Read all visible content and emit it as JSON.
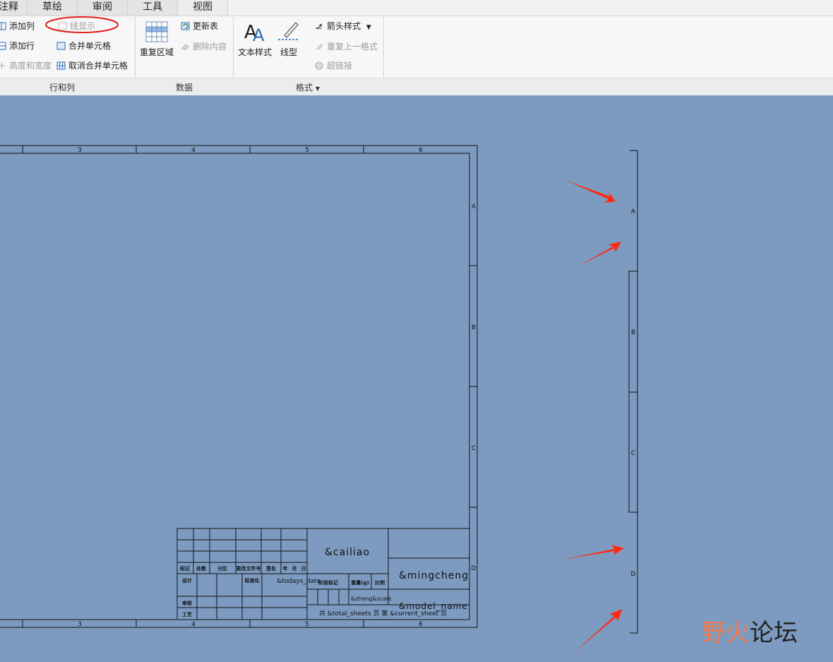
{
  "tabs": [
    "注释",
    "草绘",
    "审阅",
    "工具",
    "视图"
  ],
  "ribbon": {
    "rows_cols": {
      "add_column": "添加列",
      "add_row": "添加行",
      "height_width": "高度和宽度",
      "line_display": "线显示",
      "merge_cells": "合并单元格",
      "unmerge_cells": "取消合并单元格",
      "group_label": "行和列"
    },
    "data": {
      "repeat_region": "重复区域",
      "update_table": "更新表",
      "delete_content": "删除内容",
      "group_label": "数据"
    },
    "format": {
      "text_style": "文本样式",
      "line_style": "线型",
      "arrow_style": "箭头样式",
      "repeat_last_format": "重复上一格式",
      "hyperlink": "超链接",
      "group_label": "格式"
    }
  },
  "drawing": {
    "top_zone_labels": [
      "3",
      "4",
      "5",
      "6"
    ],
    "bottom_zone_labels": [
      "3",
      "4",
      "5",
      "6"
    ],
    "right_zone_labels": [
      "A",
      "B",
      "C",
      "D"
    ],
    "side_strip_labels": [
      "A",
      "B",
      "C",
      "D"
    ],
    "title_block": {
      "header_cells": [
        "标记",
        "处数",
        "分区",
        "更改文件号",
        "签名",
        "年",
        "月",
        "日"
      ],
      "design": "设计",
      "standardize": "标准化",
      "review": "审核",
      "process": "工艺",
      "todays_date": "&todays_date",
      "stage_mark": "阶段标记",
      "weight": "重量(g)",
      "scale": "比例",
      "material": "&cailiao",
      "name": "&mingcheng",
      "model_name": "&model_name",
      "weight_param": "&zhong&scale",
      "sheets": "共 &total_sheets 页 第 &current_sheet 页"
    }
  },
  "watermark": {
    "part1": "野火",
    "part2": "论坛"
  },
  "colors": {
    "canvas_bg": "#7d9bc1",
    "arrow": "#ff2a12",
    "highlight_circle": "#e0201a",
    "drawing_line": "#111111"
  }
}
